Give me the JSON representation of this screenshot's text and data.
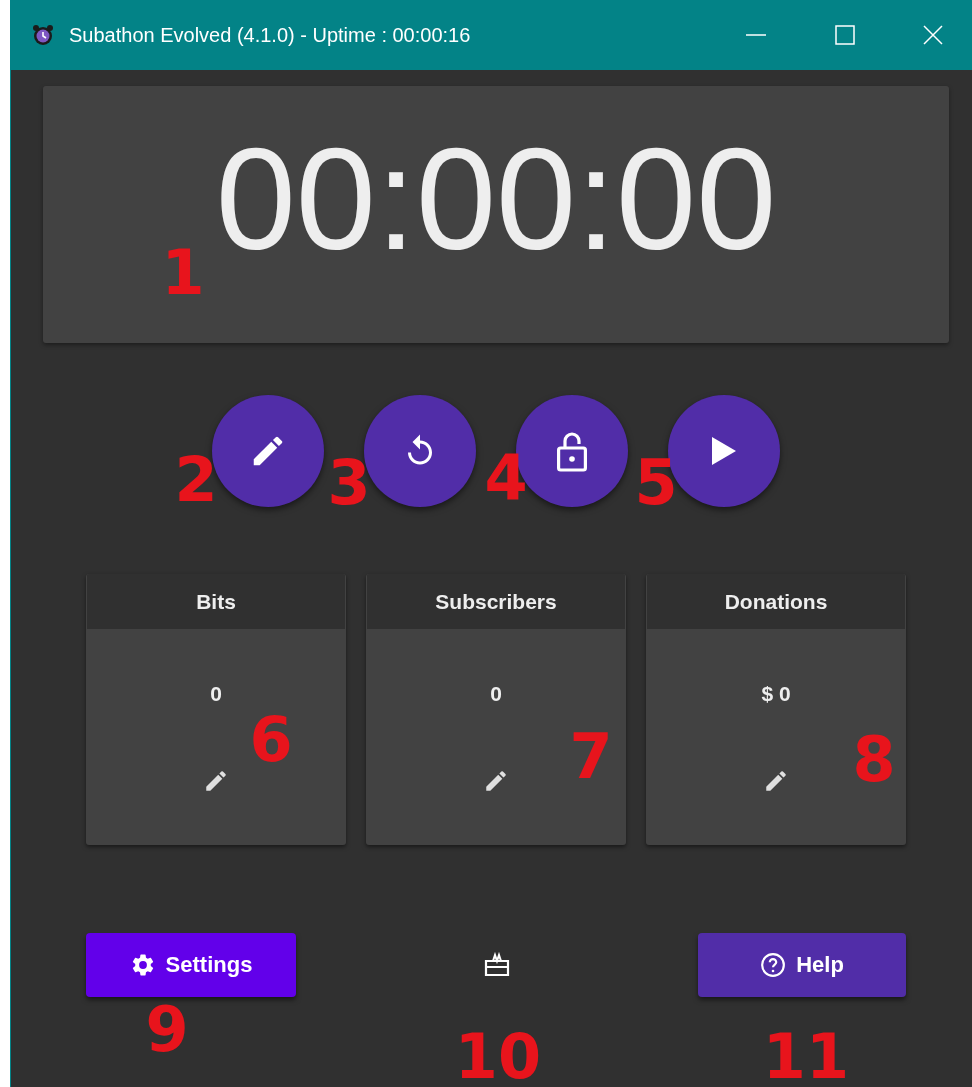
{
  "window": {
    "title": "Subathon Evolved (4.1.0) - Uptime : 00:00:16"
  },
  "timer": {
    "value": "00:00:00"
  },
  "timer_buttons": [
    {
      "kind": "edit"
    },
    {
      "kind": "reset"
    },
    {
      "kind": "lock"
    },
    {
      "kind": "play"
    }
  ],
  "counters": [
    {
      "title": "Bits",
      "value": "0"
    },
    {
      "title": "Subscribers",
      "value": "0"
    },
    {
      "title": "Donations",
      "value": "$ 0"
    }
  ],
  "footer": {
    "settings": "Settings",
    "help": "Help"
  },
  "annotations": [
    "1",
    "2",
    "3",
    "4",
    "5",
    "6",
    "7",
    "8",
    "9",
    "10",
    "11"
  ]
}
